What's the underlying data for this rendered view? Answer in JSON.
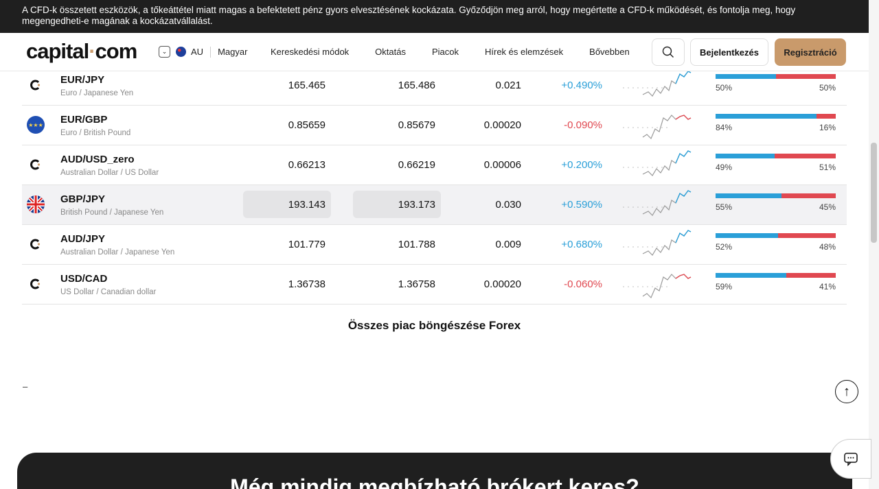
{
  "banner": {
    "text": "A CFD-k összetett eszközök, a tőkeáttétel miatt magas a befektetett pénz gyors elvesztésének kockázata. Győződjön meg arról, hogy megértette a CFD-k működését, és fontolja meg, hogy megengedheti-e magának a kockázatvállalást."
  },
  "header": {
    "logo_main": "capital",
    "logo_dot": "·",
    "logo_tld": "com",
    "region": "AU",
    "language": "Magyar",
    "nav": [
      "Kereskedési módok",
      "Oktatás",
      "Piacok",
      "Hírek és elemzések",
      "Bővebben"
    ],
    "login": "Bejelentkezés",
    "register": "Regisztráció"
  },
  "markets": [
    {
      "symbol": "EUR/JPY",
      "name": "Euro / Japanese Yen",
      "icon": "capital-logo-icon",
      "sell": "165.465",
      "buy": "165.486",
      "spread": "0.021",
      "change": "+0.490%",
      "trend": "up",
      "buy_pct": 50,
      "buy_label": "50%",
      "sell_label": "50%"
    },
    {
      "symbol": "EUR/GBP",
      "name": "Euro / British Pound",
      "icon": "eu-flag-icon",
      "sell": "0.85659",
      "buy": "0.85679",
      "spread": "0.00020",
      "change": "-0.090%",
      "trend": "down",
      "buy_pct": 84,
      "buy_label": "84%",
      "sell_label": "16%"
    },
    {
      "symbol": "AUD/USD_zero",
      "name": "Australian Dollar / US Dollar",
      "icon": "capital-logo-icon",
      "sell": "0.66213",
      "buy": "0.66219",
      "spread": "0.00006",
      "change": "+0.200%",
      "trend": "up",
      "buy_pct": 49,
      "buy_label": "49%",
      "sell_label": "51%"
    },
    {
      "symbol": "GBP/JPY",
      "name": "British Pound / Japanese Yen",
      "icon": "uk-flag-icon",
      "sell": "193.143",
      "buy": "193.173",
      "spread": "0.030",
      "change": "+0.590%",
      "trend": "up",
      "buy_pct": 55,
      "buy_label": "55%",
      "sell_label": "45%",
      "highlighted": true
    },
    {
      "symbol": "AUD/JPY",
      "name": "Australian Dollar / Japanese Yen",
      "icon": "capital-logo-icon",
      "sell": "101.779",
      "buy": "101.788",
      "spread": "0.009",
      "change": "+0.680%",
      "trend": "up",
      "buy_pct": 52,
      "buy_label": "52%",
      "sell_label": "48%"
    },
    {
      "symbol": "USD/CAD",
      "name": "US Dollar / Canadian dollar",
      "icon": "capital-logo-icon",
      "sell": "1.36738",
      "buy": "1.36758",
      "spread": "0.00020",
      "change": "-0.060%",
      "trend": "down",
      "buy_pct": 59,
      "buy_label": "59%",
      "sell_label": "41%"
    }
  ],
  "browse_link": "Összes piac böngészése Forex",
  "dash": "–",
  "promo_title": "Még mindig megbízható brókert keres?",
  "colors": {
    "accent": "#c99a6b",
    "positive": "#2a9fd8",
    "negative": "#e04850",
    "banner": "#1f1f1f"
  }
}
